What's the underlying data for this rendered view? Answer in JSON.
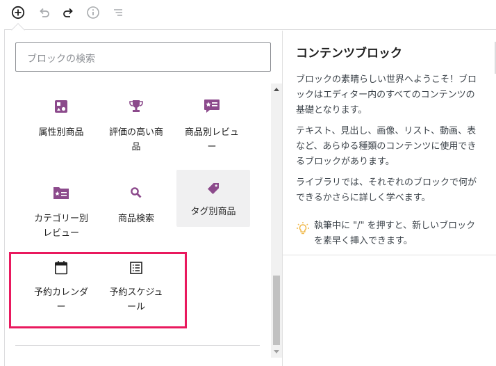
{
  "toolbar": {
    "icons": [
      "plus-circle-icon",
      "undo-icon",
      "redo-icon",
      "info-icon",
      "list-outline-icon"
    ]
  },
  "search": {
    "placeholder": "ブロックの検索"
  },
  "blocks": [
    {
      "label": "属性別商品",
      "icon": "attribute-products-icon"
    },
    {
      "label": "評価の高い商\n品",
      "icon": "trophy-icon"
    },
    {
      "label": "商品別レビュ\nー",
      "icon": "review-by-product-icon"
    },
    {
      "label": "カテゴリー別\nレビュー",
      "icon": "review-by-category-icon"
    },
    {
      "label": "商品検索",
      "icon": "product-search-icon"
    },
    {
      "label": "タグ別商品",
      "icon": "tag-icon"
    },
    {
      "label": "予約カレンダ\nー",
      "icon": "calendar-icon"
    },
    {
      "label": "予約スケジュ\nール",
      "icon": "schedule-list-icon"
    }
  ],
  "preview": {
    "title": "コンテンツブロック",
    "p1": "ブロックの素晴らしい世界へようこそ！ブロックはエディター内のすべてのコンテンツの基礎となります。",
    "p2": "テキスト、見出し、画像、リスト、動画、表など、あらゆる種類のコンテンツに使用できるブロックがあります。",
    "p3": "ライブラリでは、それぞれのブロックで何ができるかさらに詳しく学べます。",
    "tip": "執筆中に \"/\" を押すと、新しいブロックを素早く挿入できます。"
  },
  "colors": {
    "icon_purple": "#8c4a8c",
    "highlight": "#e9195e",
    "tip_bulb": "#f0b849"
  }
}
